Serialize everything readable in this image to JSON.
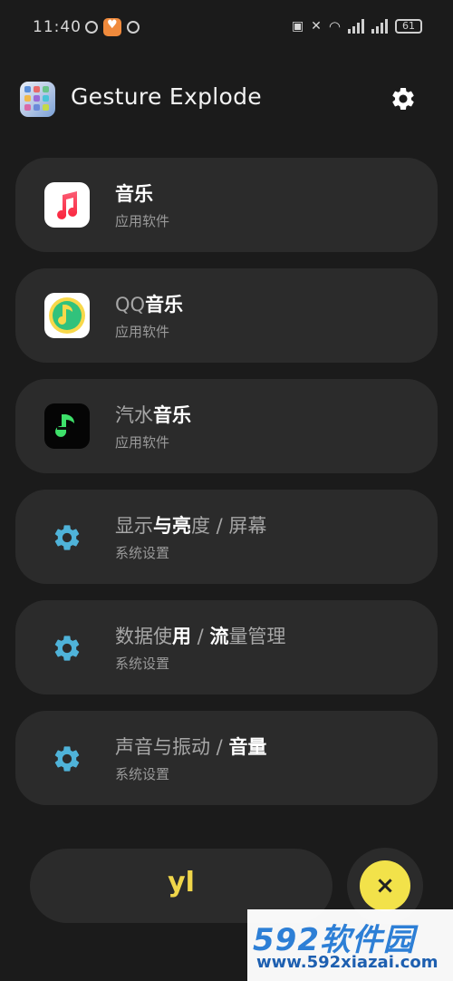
{
  "status_bar": {
    "time": "11:40",
    "battery": "61"
  },
  "header": {
    "app_title": "Gesture Explode"
  },
  "results": [
    {
      "title_dim": "",
      "title_bold": "音乐",
      "title_dim2": "",
      "subtitle": "应用软件",
      "icon": "apple-music-icon"
    },
    {
      "title_dim": "QQ",
      "title_bold": "音乐",
      "title_dim2": "",
      "subtitle": "应用软件",
      "icon": "qq-music-icon"
    },
    {
      "title_dim": "汽水",
      "title_bold": "音乐",
      "title_dim2": "",
      "subtitle": "应用软件",
      "icon": "qishui-music-icon"
    },
    {
      "title_dim": "显示",
      "title_bold": "与亮",
      "title_dim2": "度 / 屏幕",
      "subtitle": "系统设置",
      "icon": "gear-icon"
    },
    {
      "title_dim": "数据使",
      "title_bold": "用",
      "title_mid": " / ",
      "title_bold2": "流",
      "title_dim2": "量管理",
      "subtitle": "系统设置",
      "icon": "gear-icon"
    },
    {
      "title_dim": "声音与振动 / ",
      "title_bold": "音量",
      "title_dim2": "",
      "subtitle": "系统设置",
      "icon": "gear-icon"
    }
  ],
  "search": {
    "value": "yl"
  },
  "fab": {
    "label": "×"
  },
  "watermark": {
    "brand": "592软件园",
    "url": "www.592xiazai.com"
  },
  "colors": {
    "background": "#1b1b1b",
    "card": "#2b2b2b",
    "accent_gear": "#4fb3d9",
    "input_text": "#f0d64a",
    "fab": "#f2e24a"
  }
}
